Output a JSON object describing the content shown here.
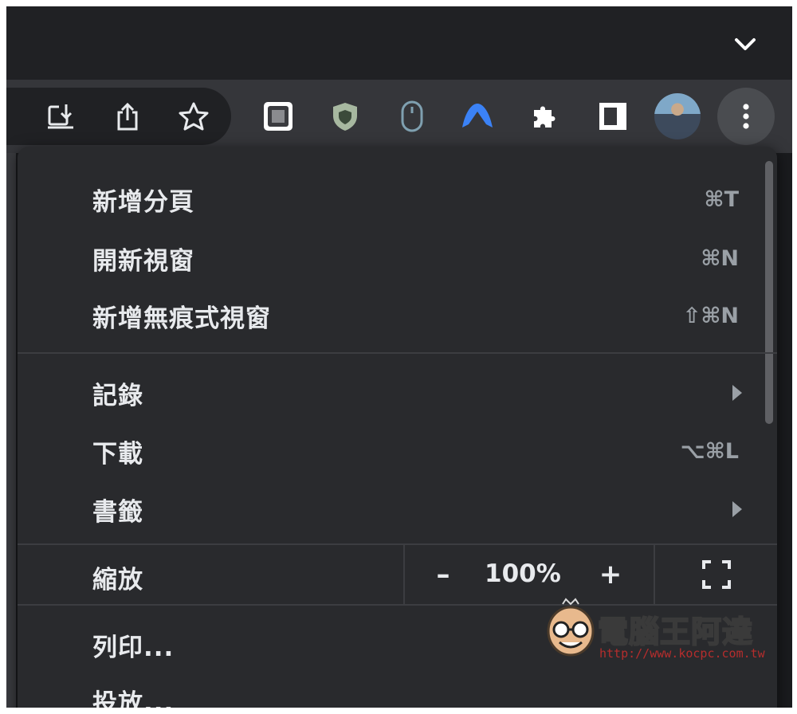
{
  "toolbar": {
    "icons": [
      "install-app-icon",
      "share-icon",
      "bookmark-star-icon",
      "screenshot-extension-icon",
      "shield-extension-icon",
      "mouse-extension-icon",
      "vpn-extension-icon",
      "extensions-puzzle-icon",
      "side-panel-icon",
      "profile-avatar",
      "more-menu-icon"
    ]
  },
  "menu": {
    "items": [
      {
        "label": "新增分頁",
        "shortcut": "⌘T"
      },
      {
        "label": "開新視窗",
        "shortcut": "⌘N"
      },
      {
        "label": "新增無痕式視窗",
        "shortcut": "⇧⌘N"
      },
      {
        "label": "記錄",
        "shortcut": ""
      },
      {
        "label": "下載",
        "shortcut": "⌥⌘L"
      },
      {
        "label": "書籤",
        "shortcut": ""
      },
      {
        "label": "列印...",
        "shortcut": ""
      },
      {
        "label": "投放...",
        "shortcut": ""
      }
    ],
    "zoom": {
      "label": "縮放",
      "minus": "–",
      "value": "100%",
      "plus": "+"
    }
  },
  "watermark": {
    "title": "電腦王阿達",
    "url": "http://www.kocpc.com.tw"
  },
  "colors": {
    "menu_bg": "#292a2d",
    "toolbar_bg": "#35363a",
    "tabstrip_bg": "#202124",
    "text": "#e8eaed",
    "muted": "#9aa0a6"
  }
}
